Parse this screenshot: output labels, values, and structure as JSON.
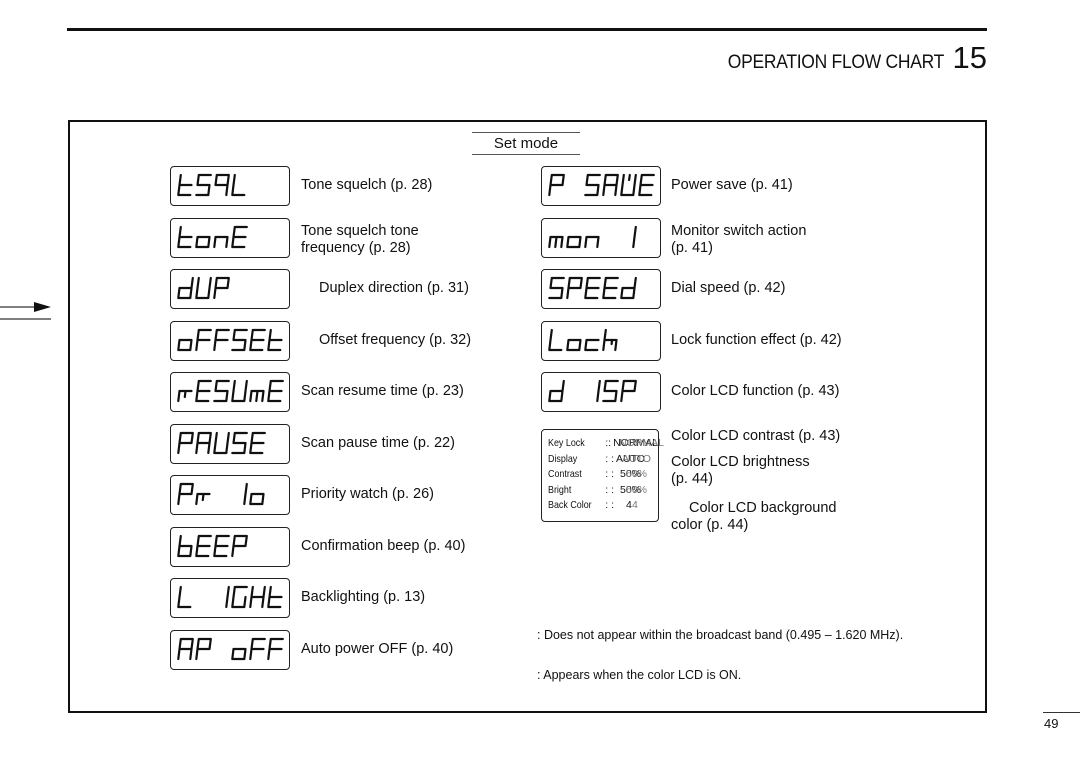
{
  "header": {
    "title": "OPERATION FLOW CHART",
    "section_number": "15"
  },
  "flowchart": {
    "heading": "Set mode",
    "left_column": [
      {
        "lcd": "tSqL",
        "desc_lines": [
          "Tone squelch (p. 28)"
        ]
      },
      {
        "lcd": "tonE",
        "desc_lines": [
          "Tone squelch tone",
          "frequency (p. 28)"
        ]
      },
      {
        "lcd": "dUP",
        "desc_lines": [
          "Duplex direction (p. 31)"
        ]
      },
      {
        "lcd": "oFFSEt",
        "desc_lines": [
          "Offset frequency (p. 32)"
        ]
      },
      {
        "lcd": "rESUmE",
        "desc_lines": [
          "Scan resume time (p. 23)"
        ]
      },
      {
        "lcd": "PAUSE",
        "desc_lines": [
          "Scan pause time (p. 22)"
        ]
      },
      {
        "lcd": "Pr Io",
        "desc_lines": [
          "Priority watch (p. 26)"
        ]
      },
      {
        "lcd": "bEEP",
        "desc_lines": [
          "Confirmation beep (p. 40)"
        ]
      },
      {
        "lcd": "L IGHt",
        "desc_lines": [
          "Backlighting (p. 13)"
        ]
      },
      {
        "lcd": "AP oFF",
        "desc_lines": [
          "Auto power OFF (p. 40)"
        ]
      }
    ],
    "right_column": [
      {
        "lcd": "P SAVE",
        "desc_lines": [
          "Power save (p. 41)"
        ]
      },
      {
        "lcd": "mon I",
        "desc_lines": [
          "Monitor switch action",
          "(p. 41)"
        ]
      },
      {
        "lcd": "SPEEd",
        "desc_lines": [
          "Dial speed (p. 42)"
        ]
      },
      {
        "lcd": "Lock",
        "desc_lines": [
          "Lock function effect (p. 42)"
        ]
      },
      {
        "lcd": "d ISP",
        "desc_lines": [
          "Color LCD function (p. 43)"
        ]
      }
    ],
    "color_lcd_panel": {
      "rows": [
        {
          "key": "Key Lock",
          "sep": "::",
          "value": "NORMAL"
        },
        {
          "key": "Display",
          "sep": ": :",
          "value": "AUTO"
        },
        {
          "key": "Contrast",
          "sep": ": :",
          "value": "50%"
        },
        {
          "key": "Bright",
          "sep": ": :",
          "value": "50%"
        },
        {
          "key": "Back Color",
          "sep": ": :",
          "value": "4"
        }
      ],
      "descriptions": [
        [
          "Color LCD contrast (p. 43)"
        ],
        [
          "Color LCD brightness",
          "(p. 44)"
        ],
        [
          "Color LCD background",
          "color (p. 44)"
        ]
      ]
    },
    "notes": [
      ": Does not appear within the broadcast band (0.495 – 1.620 MHz).",
      ": Appears when the color LCD is ON."
    ]
  },
  "page_number": "49"
}
